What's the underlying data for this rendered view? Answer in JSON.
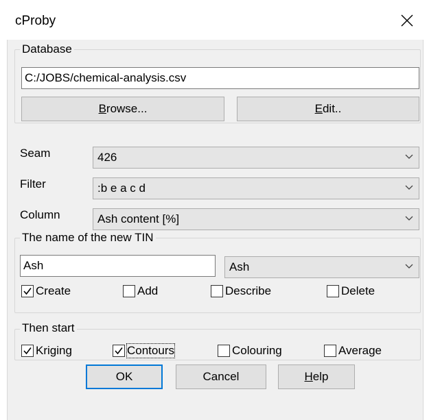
{
  "window": {
    "title": "cProby"
  },
  "database": {
    "group_label": "Database",
    "path": "C:/JOBS/chemical-analysis.csv",
    "browse": {
      "pre": "",
      "key": "B",
      "post": "rowse..."
    },
    "edit": {
      "pre": "",
      "key": "E",
      "post": "dit.."
    }
  },
  "fields": {
    "seam": {
      "label": "Seam",
      "value": "426"
    },
    "filter": {
      "label": "Filter",
      "value": ":b e a c d"
    },
    "column": {
      "label": "Column",
      "value": "Ash content [%]"
    }
  },
  "tin": {
    "group_label": "The name of the new TIN",
    "name": "Ash",
    "combo_value": "Ash",
    "checkboxes": [
      {
        "label": "Create",
        "checked": true
      },
      {
        "label": "Add",
        "checked": false
      },
      {
        "label": "Describe",
        "checked": false
      },
      {
        "label": "Delete",
        "checked": false
      }
    ]
  },
  "then_start": {
    "group_label": "Then start",
    "checkboxes": [
      {
        "label": "Kriging",
        "checked": true
      },
      {
        "label": "Contours",
        "checked": true
      },
      {
        "label": "Colouring",
        "checked": false
      },
      {
        "label": "Average",
        "checked": false
      }
    ]
  },
  "buttons": {
    "ok": "OK",
    "cancel": "Cancel",
    "help": {
      "pre": "",
      "key": "H",
      "post": "elp"
    }
  },
  "icons": {
    "close": "close-icon",
    "dropdown": "chevron-down-icon",
    "check": "check-icon"
  },
  "colors": {
    "default_button_border": "#0078d7",
    "dialog_bg": "#f0f0f0"
  }
}
